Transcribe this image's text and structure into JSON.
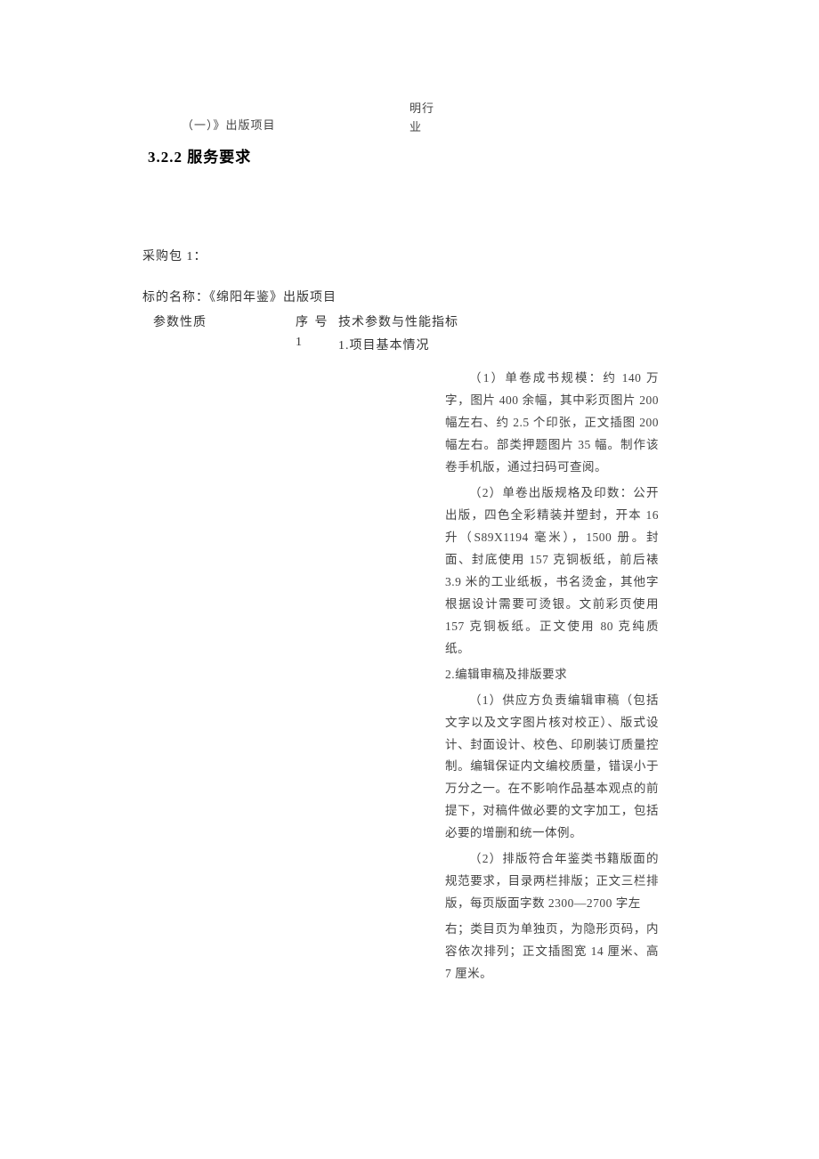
{
  "top": {
    "left_fragment": "（一）》出版项目",
    "right_fragment_line1": "明行",
    "right_fragment_line2": "业"
  },
  "heading": "3.2.2 服务要求",
  "package_label": "采购包 1：",
  "subject_line": "标的名称：《绵阳年鉴》出版项目",
  "table_headers": {
    "param": "参数性质",
    "seq": "序 号",
    "spec": "技术参数与性能指标"
  },
  "row1": {
    "seq": "1",
    "first_line": "1.项目基本情况"
  },
  "detail": {
    "p1": "（1）单卷成书规模：约 140 万字，图片 400 余幅，其中彩页图片 200 幅左右、约 2.5 个印张，正文插图 200 幅左右。部类押题图片 35 幅。制作该卷手机版，通过扫码可查阅。",
    "p2": "（2）单卷出版规格及印数：公开出版，四色全彩精装并塑封，开本 16 升（S89X1194 毫米），1500 册。封面、封底使用 157 克铜板纸，前后裱 3.9 米的工业纸板，书名烫金，其他字根据设计需要可烫银。文前彩页使用 157 克铜板纸。正文使用 80 克纯质纸。",
    "section2_title": "2.编辑审稿及排版要求",
    "p3": "（1）供应方负责编辑审稿（包括文字以及文字图片核对校正）、版式设计、封面设计、校色、印刷装订质量控制。编辑保证内文编校质量，错误小于万分之一。在不影响作品基本观点的前提下，对稿件做必要的文字加工，包括必要的增删和统一体例。",
    "p4": "（2）排版符合年鉴类书籍版面的规范要求，目录两栏排版；正文三栏排版，每页版面字数 2300—2700 字左",
    "p5": "右；类目页为单独页，为隐形页码，内容依次排列；正文插图宽 14 厘米、高 7 厘米。"
  }
}
